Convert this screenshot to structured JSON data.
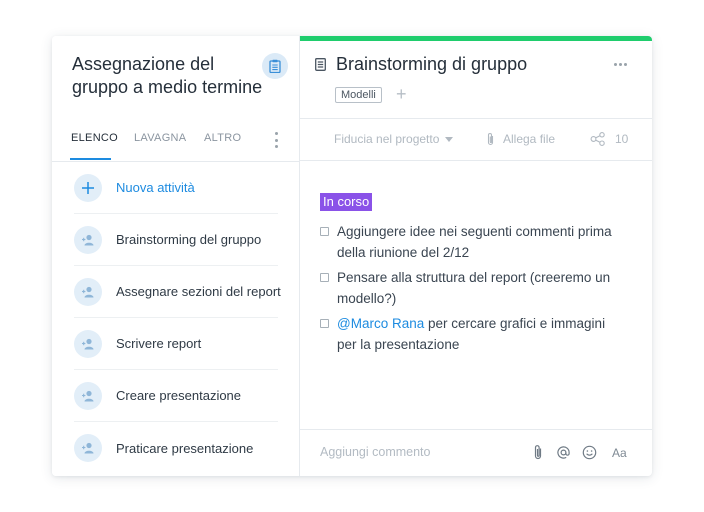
{
  "project": {
    "title": "Assegnazione del gruppo a medio termine",
    "icon": "clipboard-icon"
  },
  "tabs": [
    {
      "label": "ELENCO",
      "active": true
    },
    {
      "label": "LAVAGNA",
      "active": false
    },
    {
      "label": "ALTRO",
      "active": false
    }
  ],
  "task_list": [
    {
      "label": "Nuova attività",
      "icon": "plus-icon"
    },
    {
      "label": "Brainstorming del gruppo",
      "icon": "assign-user-icon"
    },
    {
      "label": "Assegnare sezioni del report",
      "icon": "assign-user-icon"
    },
    {
      "label": "Scrivere report",
      "icon": "assign-user-icon"
    },
    {
      "label": "Creare presentazione",
      "icon": "assign-user-icon"
    },
    {
      "label": "Praticare presentazione",
      "icon": "assign-user-icon"
    }
  ],
  "task": {
    "title": "Brainstorming di gruppo",
    "tag": "Modelli",
    "add_tag": "+",
    "project_field": "Fiducia nel progetto",
    "attach_label": "Allega file",
    "followers_count": "10",
    "status": "In corso",
    "status_color": "#8a52e8",
    "checklist": [
      {
        "text": "Aggiungere idee nei seguenti commenti prima della riunione del 2/12"
      },
      {
        "text": "Pensare alla struttura del report (creeremo un modello?)"
      },
      {
        "mention": "@Marco Rana",
        "text": " per cercare grafici e immagini per la presentazione"
      }
    ]
  },
  "comment": {
    "placeholder": "Aggiungi commento",
    "format_label": "Aa"
  },
  "colors": {
    "accent": "#1d8be0",
    "top_bar": "#1fcd6d"
  }
}
